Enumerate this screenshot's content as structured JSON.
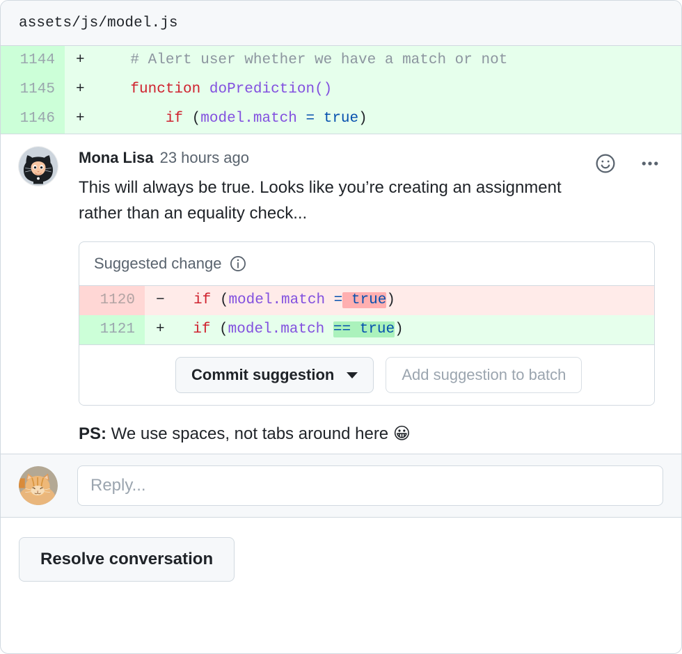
{
  "file": {
    "path": "assets/js/model.js"
  },
  "diff": {
    "rows": [
      {
        "line_number": "1144",
        "sign": "+",
        "type": "addition",
        "tokens": [
          {
            "text": "    # Alert user whether we have a match or not",
            "cls": "tk-com"
          }
        ]
      },
      {
        "line_number": "1145",
        "sign": "+",
        "type": "addition",
        "tokens": [
          {
            "text": "    ",
            "cls": "tk-pun"
          },
          {
            "text": "function",
            "cls": "tk-kw"
          },
          {
            "text": " ",
            "cls": "tk-pun"
          },
          {
            "text": "doPrediction()",
            "cls": "tk-fn"
          }
        ]
      },
      {
        "line_number": "1146",
        "sign": "+",
        "type": "addition",
        "tokens": [
          {
            "text": "        ",
            "cls": "tk-pun"
          },
          {
            "text": "if",
            "cls": "tk-kw"
          },
          {
            "text": " (",
            "cls": "tk-pun"
          },
          {
            "text": "model.match",
            "cls": "tk-var"
          },
          {
            "text": " ",
            "cls": "tk-pun"
          },
          {
            "text": "=",
            "cls": "tk-op"
          },
          {
            "text": " ",
            "cls": "tk-pun"
          },
          {
            "text": "true",
            "cls": "tk-con"
          },
          {
            "text": ")",
            "cls": "tk-pun"
          }
        ]
      }
    ]
  },
  "comment": {
    "author": "Mona Lisa",
    "timestamp": "23 hours ago",
    "body": "This will always be true. Looks like you’re creating an assignment rather than an equality check...",
    "reaction_icon": "smiley-icon",
    "menu_icon": "kebab-menu-icon",
    "avatar_alt": "mona-lisa-octocat-avatar"
  },
  "suggestion": {
    "title": "Suggested change",
    "info_icon": "info-icon",
    "rows": [
      {
        "line_number": "1120",
        "sign": "−",
        "type": "deletion"
      },
      {
        "line_number": "1121",
        "sign": "+",
        "type": "addition"
      }
    ],
    "commit_button": "Commit suggestion",
    "commit_caret_icon": "chevron-down-icon",
    "batch_button": "Add suggestion to batch"
  },
  "ps": {
    "label": "PS:",
    "text": " We use spaces, not tabs around here ",
    "emoji": "😀"
  },
  "reply": {
    "placeholder": "Reply...",
    "value": "",
    "avatar_alt": "ginger-cat-avatar"
  },
  "footer": {
    "resolve_button": "Resolve conversation"
  },
  "colors": {
    "addition_bg": "#e6ffec",
    "addition_gutter": "#ccffd8",
    "deletion_bg": "#ffebe9",
    "deletion_gutter": "#ffd7d5",
    "word_add": "#abf2bc",
    "word_del": "#ffafb0",
    "border": "#d1d9e0",
    "muted_text": "#59636e",
    "keyword": "#cf222e",
    "identifier": "#8250df",
    "constant": "#0550ae",
    "comment_token": "#8c959f"
  }
}
